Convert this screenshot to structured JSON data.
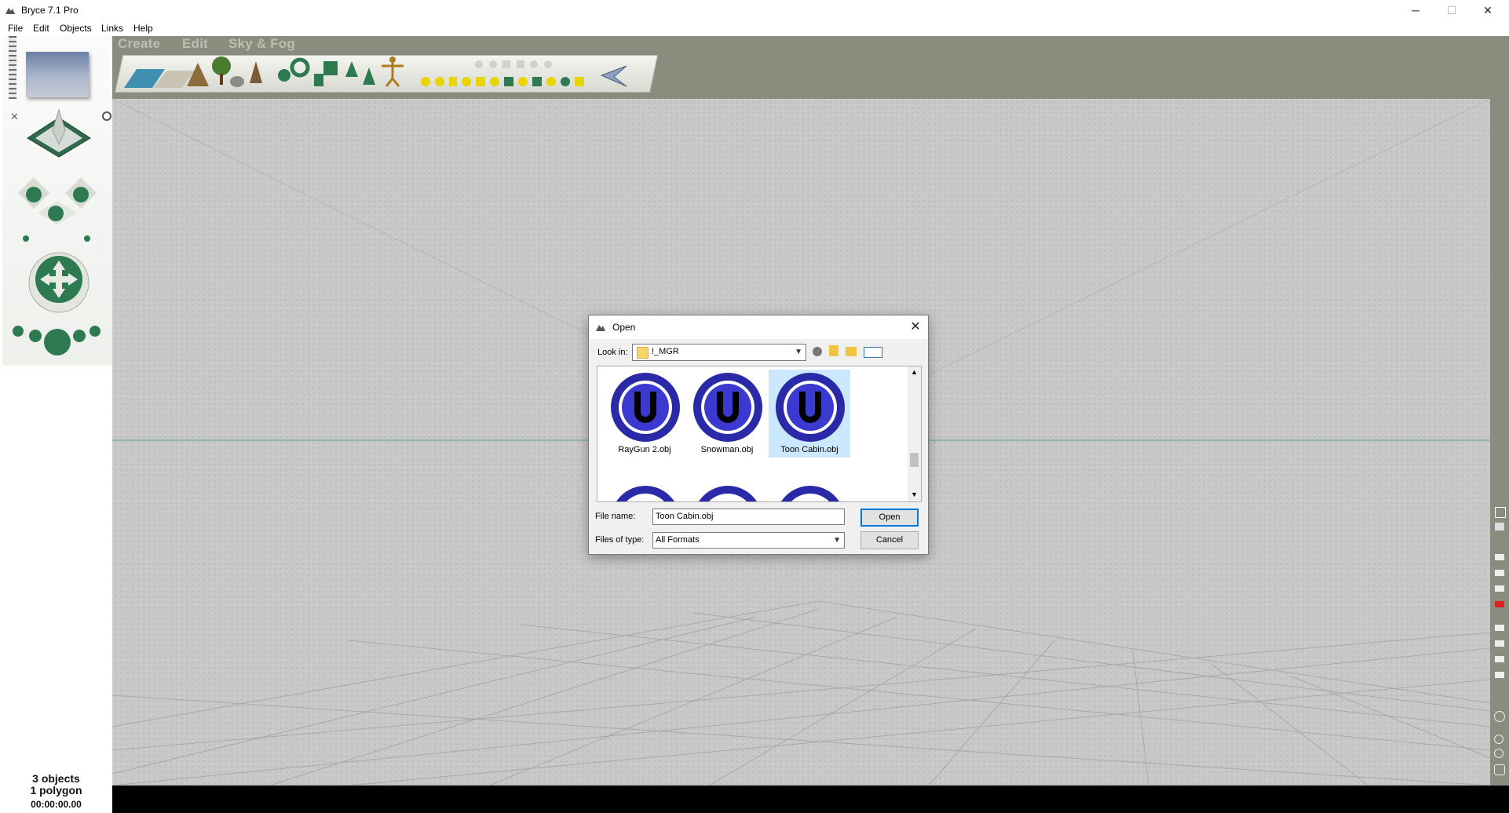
{
  "window": {
    "title": "Bryce 7.1  Pro",
    "minimize": "─",
    "maximize": "☐",
    "close": "✕"
  },
  "menu": [
    "File",
    "Edit",
    "Objects",
    "Links",
    "Help"
  ],
  "tabs": [
    "Create",
    "Edit",
    "Sky & Fog"
  ],
  "status": {
    "objects": "3 objects",
    "polygons": "1 polygon",
    "time": "00:00:00.00"
  },
  "dialog": {
    "title": "Open",
    "look_in_label": "Look in:",
    "look_in_value": "!_MGR",
    "files": [
      {
        "name": "RayGun 2.obj",
        "selected": false
      },
      {
        "name": "Snowman.obj",
        "selected": false
      },
      {
        "name": "Toon Cabin.obj",
        "selected": true
      }
    ],
    "file_name_label": "File name:",
    "file_name_value": "Toon Cabin.obj",
    "file_type_label": "Files of type:",
    "file_type_value": "All Formats",
    "open_button": "Open",
    "cancel_button": "Cancel"
  }
}
